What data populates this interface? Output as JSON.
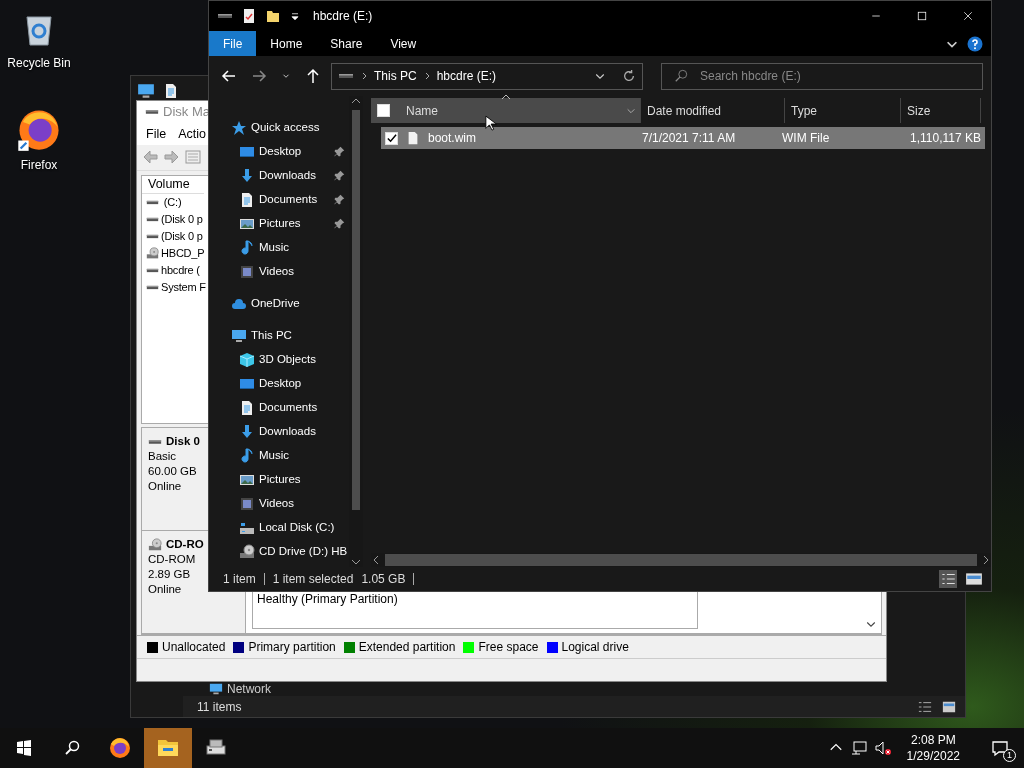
{
  "desktop_icons": [
    {
      "label": "Recycle Bin",
      "kind": "recycle"
    },
    {
      "label": "Firefox",
      "kind": "firefox"
    }
  ],
  "back_window": {
    "nav_item": "Network",
    "status": "11 items"
  },
  "disk_management": {
    "title": "Disk Ma",
    "menu": [
      "File",
      "Actio"
    ],
    "volume_header": "Volume",
    "volumes": [
      {
        "label": " (C:)",
        "kind": "disk"
      },
      {
        "label": "(Disk 0 p",
        "kind": "disk"
      },
      {
        "label": "(Disk 0 p",
        "kind": "disk"
      },
      {
        "label": "HBCD_P",
        "kind": "cd"
      },
      {
        "label": "hbcdre (",
        "kind": "disk"
      },
      {
        "label": "System F",
        "kind": "disk"
      }
    ],
    "disks": [
      {
        "name": "Disk 0",
        "kind": "disk",
        "lines": [
          "Basic",
          "60.00 GB",
          "Online"
        ]
      },
      {
        "name": "CD-RO",
        "kind": "cd",
        "lines": [
          "CD-ROM",
          "2.89 GB",
          "Online"
        ]
      }
    ],
    "partition_status": "Healthy (Primary Partition)",
    "legend": [
      {
        "label": "Unallocated",
        "color": "#000000"
      },
      {
        "label": "Primary partition",
        "color": "#000080"
      },
      {
        "label": "Extended partition",
        "color": "#008000"
      },
      {
        "label": "Free space",
        "color": "#00ff00"
      },
      {
        "label": "Logical drive",
        "color": "#0000ff"
      }
    ]
  },
  "explorer": {
    "title": "hbcdre (E:)",
    "ribbon_tabs": [
      {
        "label": "File",
        "selected": true
      },
      {
        "label": "Home",
        "selected": false
      },
      {
        "label": "Share",
        "selected": false
      },
      {
        "label": "View",
        "selected": false
      }
    ],
    "breadcrumb": [
      "This PC",
      "hbcdre (E:)"
    ],
    "search": {
      "placeholder": "Search hbcdre (E:)"
    },
    "nav": [
      {
        "label": "Quick access",
        "kind": "star",
        "children": [
          {
            "label": "Desktop",
            "kind": "desktop",
            "pinned": true
          },
          {
            "label": "Downloads",
            "kind": "download",
            "pinned": true
          },
          {
            "label": "Documents",
            "kind": "document",
            "pinned": true
          },
          {
            "label": "Pictures",
            "kind": "picture",
            "pinned": true
          },
          {
            "label": "Music",
            "kind": "music",
            "pinned": false
          },
          {
            "label": "Videos",
            "kind": "video",
            "pinned": false
          }
        ]
      },
      {
        "label": "OneDrive",
        "kind": "cloud"
      },
      {
        "label": "This PC",
        "kind": "pc",
        "children": [
          {
            "label": "3D Objects",
            "kind": "cube"
          },
          {
            "label": "Desktop",
            "kind": "desktop"
          },
          {
            "label": "Documents",
            "kind": "document"
          },
          {
            "label": "Downloads",
            "kind": "download"
          },
          {
            "label": "Music",
            "kind": "music"
          },
          {
            "label": "Pictures",
            "kind": "picture"
          },
          {
            "label": "Videos",
            "kind": "video"
          },
          {
            "label": "Local Disk (C:)",
            "kind": "drive"
          },
          {
            "label": "CD Drive (D:) HB",
            "kind": "cd"
          }
        ]
      }
    ],
    "columns": [
      "Name",
      "Date modified",
      "Type",
      "Size"
    ],
    "select_all_checked": false,
    "rows": [
      {
        "name": "boot.wim",
        "date": "7/1/2021 7:11 AM",
        "type": "WIM File",
        "size": "1,110,117 KB",
        "selected": true,
        "checked": true
      }
    ],
    "status": {
      "count": "1 item",
      "selection": "1 item selected",
      "size": "1.05 GB"
    }
  },
  "taskbar": {
    "apps": [
      {
        "kind": "firefox",
        "active": false
      },
      {
        "kind": "explorer",
        "active": true
      },
      {
        "kind": "diskmgmt",
        "active": false
      }
    ],
    "time": "2:08 PM",
    "date": "1/29/2022",
    "notifications": "1"
  }
}
